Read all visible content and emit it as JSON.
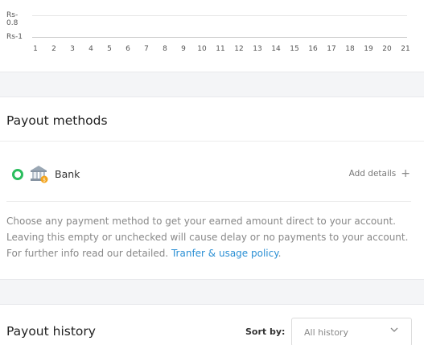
{
  "chart": {
    "yticks": [
      "Rs-0.8",
      "Rs-1"
    ],
    "xticks": [
      "1",
      "2",
      "3",
      "4",
      "5",
      "6",
      "7",
      "8",
      "9",
      "10",
      "11",
      "12",
      "13",
      "14",
      "15",
      "16",
      "17",
      "18",
      "19",
      "20",
      "21"
    ]
  },
  "payout_methods": {
    "title": "Payout methods",
    "method": {
      "label": "Bank",
      "selected": false,
      "add_details_label": "Add details",
      "radio_color": "#2bbd5e"
    },
    "note": {
      "text": "Choose any payment method to get your earned amount direct to your account. Leaving this empty or unchecked will cause delay or no payments to your account. For further info read our detailed. ",
      "link_text": "Tranfer & usage policy",
      "suffix": "."
    }
  },
  "payout_history": {
    "title": "Payout history",
    "sort_label": "Sort by:",
    "sort_value": "All history"
  }
}
